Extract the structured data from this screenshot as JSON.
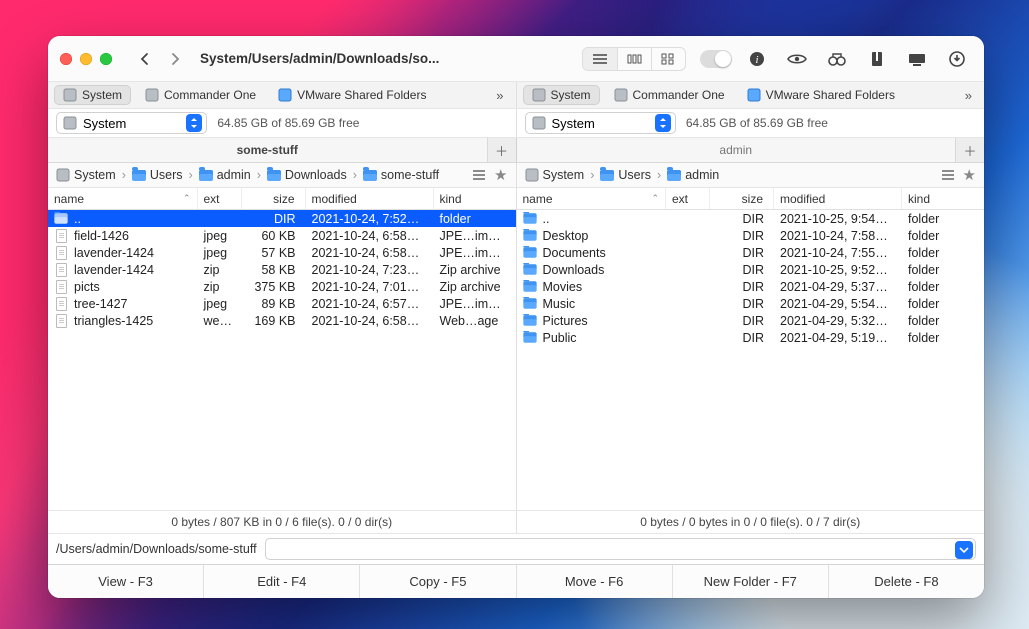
{
  "window": {
    "title": "System/Users/admin/Downloads/so..."
  },
  "favorites": [
    {
      "label": "System",
      "active": true,
      "blue": false
    },
    {
      "label": "Commander One",
      "active": false,
      "blue": false
    },
    {
      "label": "VMware Shared Folders",
      "active": false,
      "blue": true
    }
  ],
  "volume": {
    "name": "System",
    "free": "64.85 GB of 85.69 GB free"
  },
  "left": {
    "tab": "some-stuff",
    "breadcrumbs": [
      "System",
      "Users",
      "admin",
      "Downloads",
      "some-stuff"
    ],
    "columns": {
      "name": "name",
      "ext": "ext",
      "size": "size",
      "mod": "modified",
      "kind": "kind"
    },
    "rows": [
      {
        "icon": "folder",
        "name": "..",
        "ext": "",
        "size": "DIR",
        "mod": "2021-10-24, 7:52…",
        "kind": "folder",
        "sel": true
      },
      {
        "icon": "file",
        "name": "field-1426",
        "ext": "jpeg",
        "size": "60 KB",
        "mod": "2021-10-24, 6:58…",
        "kind": "JPE…image"
      },
      {
        "icon": "file",
        "name": "lavender-1424",
        "ext": "jpeg",
        "size": "57 KB",
        "mod": "2021-10-24, 6:58…",
        "kind": "JPE…image"
      },
      {
        "icon": "file",
        "name": "lavender-1424",
        "ext": "zip",
        "size": "58 KB",
        "mod": "2021-10-24, 7:23…",
        "kind": "Zip archive"
      },
      {
        "icon": "file",
        "name": "picts",
        "ext": "zip",
        "size": "375 KB",
        "mod": "2021-10-24, 7:01…",
        "kind": "Zip archive"
      },
      {
        "icon": "file",
        "name": "tree-1427",
        "ext": "jpeg",
        "size": "89 KB",
        "mod": "2021-10-24, 6:57…",
        "kind": "JPE…image"
      },
      {
        "icon": "file",
        "name": "triangles-1425",
        "ext": "we…",
        "size": "169 KB",
        "mod": "2021-10-24, 6:58…",
        "kind": "Web…age"
      }
    ],
    "status": "0 bytes / 807 KB in 0 / 6 file(s). 0 / 0 dir(s)"
  },
  "right": {
    "tab": "admin",
    "breadcrumbs": [
      "System",
      "Users",
      "admin"
    ],
    "columns": {
      "name": "name",
      "ext": "ext",
      "size": "size",
      "mod": "modified",
      "kind": "kind"
    },
    "rows": [
      {
        "icon": "folder",
        "name": "..",
        "ext": "",
        "size": "DIR",
        "mod": "2021-10-25, 9:54…",
        "kind": "folder"
      },
      {
        "icon": "folder",
        "name": "Desktop",
        "ext": "",
        "size": "DIR",
        "mod": "2021-10-24, 7:58…",
        "kind": "folder"
      },
      {
        "icon": "folder",
        "name": "Documents",
        "ext": "",
        "size": "DIR",
        "mod": "2021-10-24, 7:55…",
        "kind": "folder"
      },
      {
        "icon": "folder",
        "name": "Downloads",
        "ext": "",
        "size": "DIR",
        "mod": "2021-10-25, 9:52…",
        "kind": "folder"
      },
      {
        "icon": "folder",
        "name": "Movies",
        "ext": "",
        "size": "DIR",
        "mod": "2021-04-29, 5:37…",
        "kind": "folder"
      },
      {
        "icon": "folder",
        "name": "Music",
        "ext": "",
        "size": "DIR",
        "mod": "2021-04-29, 5:54…",
        "kind": "folder"
      },
      {
        "icon": "folder",
        "name": "Pictures",
        "ext": "",
        "size": "DIR",
        "mod": "2021-04-29, 5:32…",
        "kind": "folder"
      },
      {
        "icon": "folder",
        "name": "Public",
        "ext": "",
        "size": "DIR",
        "mod": "2021-04-29, 5:19…",
        "kind": "folder"
      }
    ],
    "status": "0 bytes / 0 bytes in 0 / 0 file(s). 0 / 7 dir(s)"
  },
  "cmd_path": "/Users/admin/Downloads/some-stuff",
  "buttons": {
    "view": "View - F3",
    "edit": "Edit - F4",
    "copy": "Copy - F5",
    "move": "Move - F6",
    "newdir": "New Folder - F7",
    "delete": "Delete - F8"
  }
}
